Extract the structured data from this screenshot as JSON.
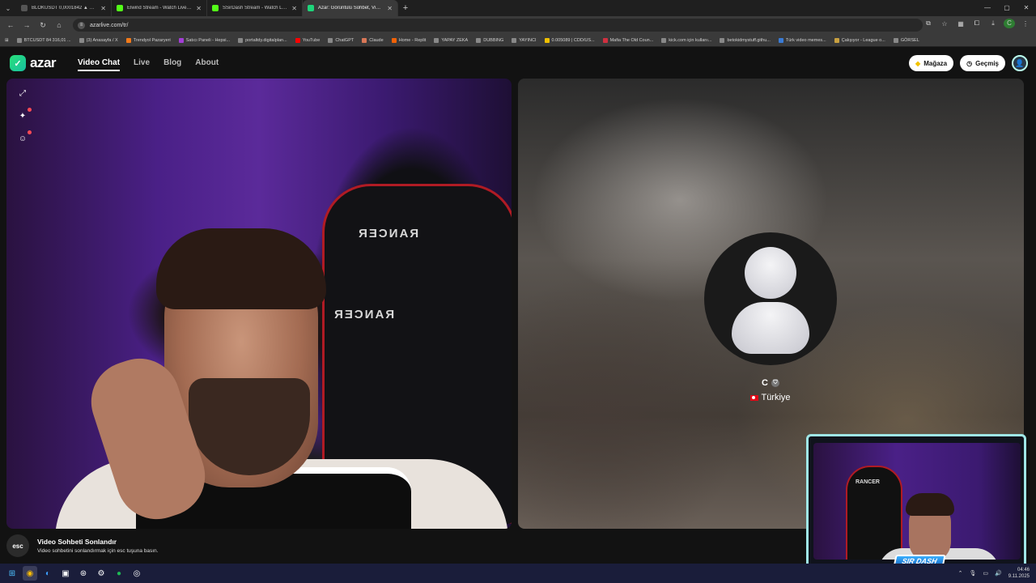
{
  "browser": {
    "tabs": [
      {
        "title": "BLOKUSDT 0,0001842 ▲ +13,8%",
        "color": "#222222",
        "active": false
      },
      {
        "title": "Elwind Stream - Watch Live on Kick",
        "color": "#53fc18",
        "active": false
      },
      {
        "title": "SSirDash Stream - Watch Live on Kick",
        "color": "#53fc18",
        "active": false
      },
      {
        "title": "Azar: Görüntülü Sohbet, Video Chat",
        "color": "#1ed47a",
        "active": true
      }
    ],
    "url": "azarlive.com/tr/",
    "bookmarks": [
      "BTCUSDT 84 316,01 ...",
      "(3) Anasayfa / X",
      "Trendyol Pazaryeri",
      "Satıcı Paneli - Hepsi...",
      "portaltdy.digitalplan...",
      "YouTube",
      "ChatGPT",
      "Claude",
      "Home - Replit",
      "YAPAY ZEKA",
      "DUBBING",
      "YAYINCI",
      "0.005089 | CDD/US...",
      "Mafia The Old Coun...",
      "kick.com için kullanı...",
      "betokidmystuff.githu...",
      "Türk video memes...",
      "Çalışıyor - League o...",
      "GÖRSEL"
    ],
    "profile_initial": "C"
  },
  "site": {
    "logo_text": "azar",
    "nav": [
      "Video Chat",
      "Live",
      "Blog",
      "About"
    ],
    "shop_label": "Mağaza",
    "history_label": "Geçmiş"
  },
  "remote": {
    "name": "C",
    "country": "Türkiye"
  },
  "end_hint": {
    "key": "esc",
    "title": "Video Sohbeti Sonlandır",
    "subtitle": "Video sohbetini sonlandırmak için esc tuşuna basın."
  },
  "local_video": {
    "chair_brand": "RANCER",
    "overlay_tag": "SIR DASH"
  },
  "taskbar": {
    "time": "04:46",
    "date": "9.11.2025"
  }
}
